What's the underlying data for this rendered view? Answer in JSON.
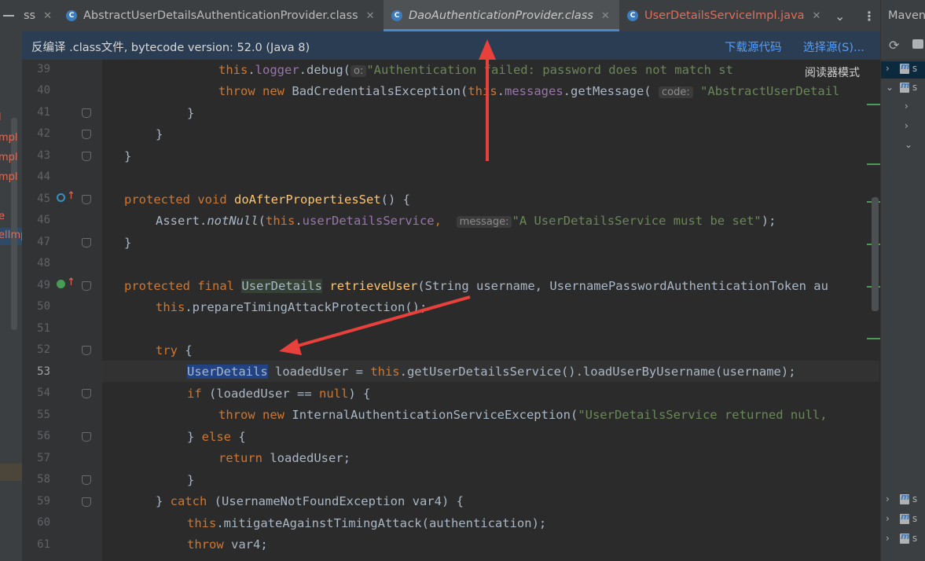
{
  "left_panel": {
    "fragments": [
      "l",
      "mpl",
      "mpl",
      "mpl",
      "e",
      "elImp"
    ]
  },
  "tabs": [
    {
      "label": "ss",
      "icon": "class-icon"
    },
    {
      "label": "AbstractUserDetailsAuthenticationProvider.class",
      "icon": "class-icon"
    },
    {
      "label": "DaoAuthenticationProvider.class",
      "icon": "class-icon",
      "active": true
    },
    {
      "label": "UserDetailsServiceImpl.java",
      "icon": "class-icon",
      "modified": true
    }
  ],
  "tab_close": "✕",
  "tab_menu_icon": "chevron-down-icon",
  "banner": {
    "message": "反编译 .class文件, bytecode version: 52.0 (Java 8)",
    "download_source": "下载源代码",
    "choose_source": "选择源(S)..."
  },
  "reader_mode": "阅读器模式",
  "maven": {
    "title": "Maven",
    "rows": [
      "s",
      "s",
      "",
      "",
      "",
      "s",
      "s",
      "s"
    ]
  },
  "editor": {
    "current_line": 53,
    "line_numbers": [
      39,
      40,
      41,
      42,
      43,
      44,
      45,
      46,
      47,
      48,
      49,
      50,
      51,
      52,
      53,
      54,
      55,
      56,
      57,
      58,
      59,
      60,
      61
    ],
    "hints": {
      "o": "o:",
      "code": "code:",
      "message": "message:"
    },
    "code": {
      "l39": [
        "this",
        ".",
        "logger",
        ".debug(",
        "\"Authentication failed: password does not match st"
      ],
      "l40": [
        "throw",
        "new",
        "BadCredentialsException(",
        "this",
        ".",
        "messages",
        ".getMessage(",
        "\"AbstractUserDetail"
      ],
      "l41": "}",
      "l42": "}",
      "l43": "}",
      "l45": [
        "protected",
        "void",
        "doAfterPropertiesSet",
        "() {"
      ],
      "l46": [
        "Assert.",
        "notNull",
        "(",
        "this",
        ".",
        "userDetailsService",
        ",",
        "\"A UserDetailsService must be set\"",
        ");"
      ],
      "l47": "}",
      "l49": [
        "protected",
        "final",
        "UserDetails",
        "retrieveUser",
        "(String username, UsernamePasswordAuthenticationToken au"
      ],
      "l50": [
        "this",
        ".prepareTimingAttackProtection();"
      ],
      "l52": [
        "try",
        " {"
      ],
      "l53": [
        "UserDetails",
        " loadedUser = ",
        "this",
        ".getUserDetailsService().loadUserByUsername(username);"
      ],
      "l54": [
        "if",
        " (loadedUser == ",
        "null",
        ") {"
      ],
      "l55": [
        "throw",
        "new",
        "InternalAuthenticationServiceException(",
        "\"UserDetailsService returned null, "
      ],
      "l56": [
        "} ",
        "else",
        " {"
      ],
      "l57": [
        "return",
        " loadedUser;"
      ],
      "l58": "}",
      "l59": [
        "} ",
        "catch",
        " (UsernameNotFoundException var4) {"
      ],
      "l60": [
        "this",
        ".mitigateAgainstTimingAttack(authentication);"
      ],
      "l61": [
        "throw",
        " var4;"
      ]
    }
  },
  "colors": {
    "keyword": "#cc7832",
    "field": "#9876aa",
    "string": "#6a8759",
    "method": "#ffc66d",
    "arrow": "#e8403a"
  }
}
